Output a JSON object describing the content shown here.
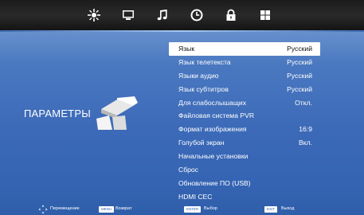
{
  "topbar": {
    "tabs": [
      {
        "name": "picture-tab",
        "icon": "sun-icon"
      },
      {
        "name": "sound-tab",
        "icon": "tv-icon"
      },
      {
        "name": "music-tab",
        "icon": "music-note-icon"
      },
      {
        "name": "time-tab",
        "icon": "clock-icon"
      },
      {
        "name": "lock-tab",
        "icon": "lock-icon"
      },
      {
        "name": "settings-tab",
        "icon": "grid-icon"
      }
    ]
  },
  "page": {
    "title": "ПАРАМЕТРЫ",
    "icon": "settings-blocks-icon"
  },
  "menu": {
    "items": [
      {
        "label": "Язык",
        "value": "Русский"
      },
      {
        "label": "Язык телетекста",
        "value": "Русский"
      },
      {
        "label": "Языки аудио",
        "value": "Русский"
      },
      {
        "label": "Язык субтитров",
        "value": "Русский"
      },
      {
        "label": "Для слабослышащих",
        "value": "Откл."
      },
      {
        "label": "Файловая система PVR",
        "value": ""
      },
      {
        "label": "Формат изображения",
        "value": "16:9"
      },
      {
        "label": "Голубой экран",
        "value": "Вкл."
      },
      {
        "label": "Начальные установки",
        "value": ""
      },
      {
        "label": "Сброс",
        "value": ""
      },
      {
        "label": "Обновление ПО (USB)",
        "value": ""
      },
      {
        "label": "HDMI CEC",
        "value": ""
      }
    ],
    "selected_index": 0
  },
  "bottombar": {
    "move_label": "Перемещение",
    "menu_key": "MENU",
    "menu_label": "Возврат",
    "enter_key": "ENTER",
    "enter_label": "Выбор",
    "exit_key": "EXIT",
    "exit_label": "Выход"
  },
  "colors": {
    "topbar": "#1b1b1b",
    "background": "#3c6ab8",
    "selected_row": "#ffffff"
  }
}
